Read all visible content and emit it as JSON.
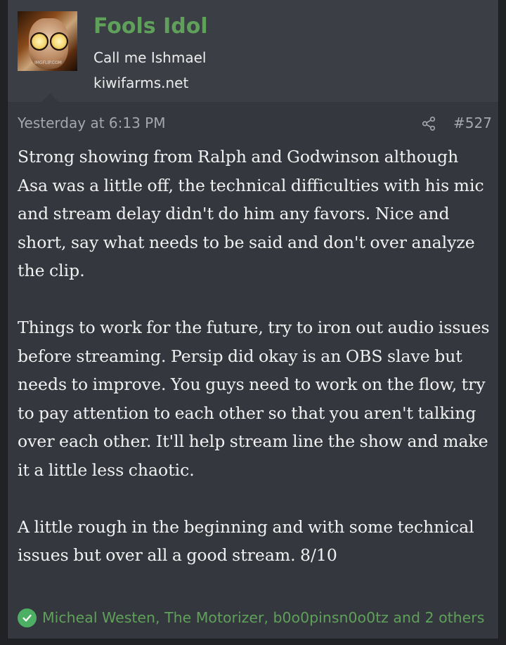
{
  "user": {
    "name": "Fools Idol",
    "title": "Call me Ishmael",
    "banner": "kiwifarms.net",
    "avatar_watermark": "IMGFLIP.COM"
  },
  "post": {
    "date": "Yesterday at 6:13 PM",
    "number": "#527",
    "share_icon": "share-icon",
    "paragraphs": [
      "Strong showing from Ralph and Godwinson although Asa was a little off, the technical difficulties with his mic and stream delay didn't do him any favors. Nice and short, say what needs to be said and don't over analyze the clip.",
      "Things to work for the future, try to iron out audio issues before streaming. Persip did okay is an OBS slave but needs to improve. You guys need to work on the flow, try to pay attention to each other so that you aren't talking over each other. It'll help stream line the show and make it a little less chaotic.",
      "A little rough in the beginning and with some technical issues but over all a good stream. 8/10"
    ]
  },
  "reactions": {
    "icon": "check-circle-icon",
    "text": "Micheal Westen, The Motorizer, b0o0pinsn0o0tz and 2 others"
  },
  "colors": {
    "username": "#5fa05a",
    "reaction_icon": "#4caf63",
    "post_bg": "#34373d",
    "user_block_bg": "#3b3e44"
  }
}
